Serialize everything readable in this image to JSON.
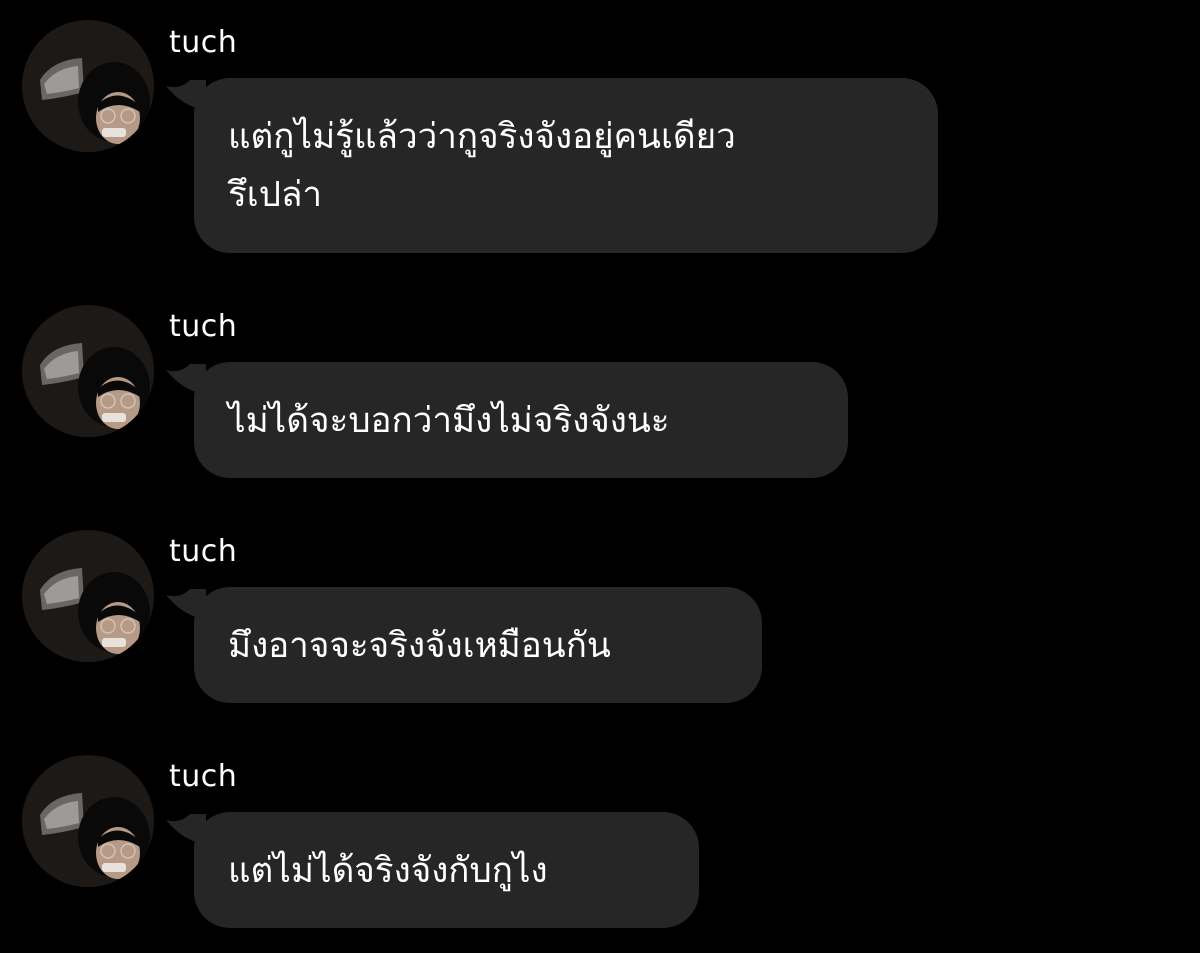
{
  "messages": [
    {
      "sender": "tuch",
      "text": "แต่กูไม่รู้แล้วว่ากูจริงจังอยู่คนเดียว\nรึเปล่า"
    },
    {
      "sender": "tuch",
      "text": "ไม่ได้จะบอกว่ามึงไม่จริงจังนะ"
    },
    {
      "sender": "tuch",
      "text": "มึงอาจจะจริงจังเหมือนกัน"
    },
    {
      "sender": "tuch",
      "text": "แต่ไม่ได้จริงจังกับกูไง"
    }
  ],
  "colors": {
    "background": "#000000",
    "bubble": "#262626",
    "text": "#ffffff"
  },
  "icons": {
    "avatar": "profile-photo-avatar"
  }
}
